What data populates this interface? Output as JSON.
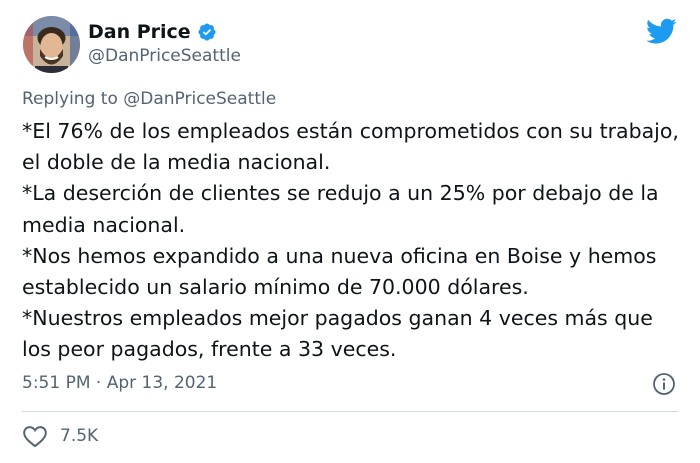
{
  "author": {
    "name": "Dan Price",
    "handle": "@DanPriceSeattle",
    "verified": true
  },
  "reply": {
    "prefix": "Replying to ",
    "mention": "@DanPriceSeattle"
  },
  "tweet": {
    "lines": [
      "*El 76% de los empleados están comprometidos con su trabajo, el doble de la media nacional.",
      "*La deserción de clientes se redujo a un 25% por debajo de la media nacional.",
      "*Nos hemos expandido a una nueva oficina en Boise y hemos establecido un salario mínimo de 70.000 dólares.",
      "*Nuestros empleados mejor pagados ganan 4 veces más que los peor pagados, frente a 33 veces."
    ]
  },
  "meta": {
    "time": "5:51 PM · Apr 13, 2021"
  },
  "engagement": {
    "likes": "7.5K"
  },
  "colors": {
    "twitter_blue": "#1d9bf0",
    "muted": "#536471",
    "text": "#0f1419"
  },
  "icons": [
    "avatar",
    "verified-badge-icon",
    "twitter-bird-icon",
    "info-icon",
    "heart-icon"
  ]
}
